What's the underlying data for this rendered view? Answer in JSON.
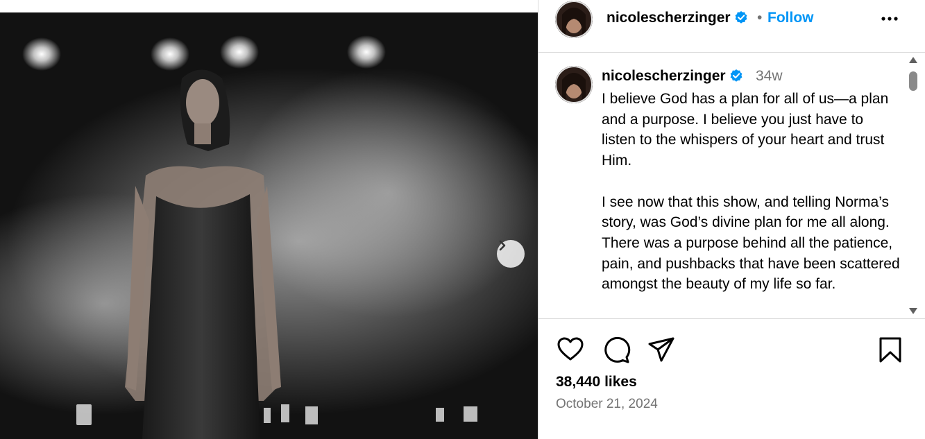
{
  "post": {
    "username": "nicolescherzinger",
    "follow_label": "Follow",
    "separator": "•",
    "time_ago": "34w",
    "caption": "I believe God has a plan for all of us—a plan and a purpose. I believe you just have to listen to the whispers of your heart and trust Him.\n\nI see now that this show, and telling Norma’s story, was God’s divine plan for me all along. There was a purpose behind all the patience, pain, and pushbacks that have been scattered amongst the beauty of my life so far.",
    "likes": "38,440 likes",
    "date": "October 21, 2024"
  },
  "icons": {
    "verified": "verified-badge-icon",
    "more": "more-options-icon",
    "like": "heart-icon",
    "comment": "comment-icon",
    "share": "share-icon",
    "save": "bookmark-icon",
    "next": "chevron-right-icon"
  },
  "colors": {
    "accent": "#0095f6",
    "muted": "#737373",
    "border": "#dbdbdb"
  }
}
